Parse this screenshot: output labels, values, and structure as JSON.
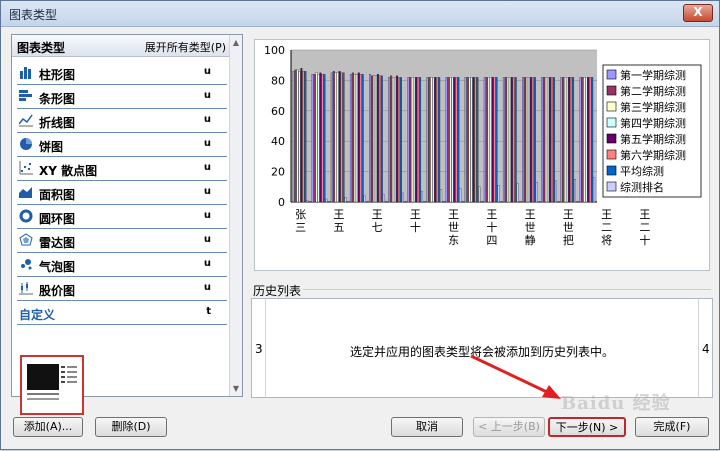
{
  "window": {
    "title": "图表类型",
    "close_label": "X"
  },
  "left_panel": {
    "header_title": "图表类型",
    "header_expand": "展开所有类型(P)",
    "items": [
      {
        "label": "柱形图",
        "mark": "u",
        "icon": "column-chart-icon"
      },
      {
        "label": "条形图",
        "mark": "u",
        "icon": "bar-chart-icon"
      },
      {
        "label": "折线图",
        "mark": "u",
        "icon": "line-chart-icon"
      },
      {
        "label": "饼图",
        "mark": "u",
        "icon": "pie-chart-icon"
      },
      {
        "label": "XY 散点图",
        "mark": "u",
        "icon": "scatter-chart-icon"
      },
      {
        "label": "面积图",
        "mark": "u",
        "icon": "area-chart-icon"
      },
      {
        "label": "圆环图",
        "mark": "u",
        "icon": "doughnut-chart-icon"
      },
      {
        "label": "雷达图",
        "mark": "u",
        "icon": "radar-chart-icon"
      },
      {
        "label": "气泡图",
        "mark": "u",
        "icon": "bubble-chart-icon"
      },
      {
        "label": "股价图",
        "mark": "u",
        "icon": "stock-chart-icon"
      }
    ],
    "custom": {
      "label": "自定义",
      "mark": "t"
    }
  },
  "chart_data": {
    "type": "bar",
    "ylim": [
      0,
      100
    ],
    "yticks": [
      "100",
      "80",
      "60",
      "40",
      "20",
      "0"
    ],
    "categories": [
      "张三",
      "王五",
      "王七",
      "王十",
      "王世东",
      "王十四",
      "王世静",
      "王世把",
      "王二将",
      "王二十"
    ],
    "groups_count": 16,
    "group_label_every": 2,
    "series": [
      {
        "name": "第一学期综测",
        "color": "#9999ff",
        "values": [
          86,
          84,
          85,
          84,
          84,
          82,
          82,
          82,
          82,
          82,
          82,
          82,
          82,
          82,
          82,
          82
        ]
      },
      {
        "name": "第二学期综测",
        "color": "#993366",
        "values": [
          87,
          84,
          86,
          85,
          83,
          83,
          82,
          82,
          82,
          82,
          82,
          82,
          82,
          82,
          82,
          82
        ]
      },
      {
        "name": "第三学期综测",
        "color": "#ffffcc",
        "values": [
          87,
          85,
          85,
          84,
          83,
          82,
          82,
          82,
          82,
          82,
          82,
          82,
          82,
          82,
          82,
          82
        ]
      },
      {
        "name": "第四学期综测",
        "color": "#ccffff",
        "values": [
          86,
          84,
          85,
          84,
          83,
          82,
          82,
          82,
          82,
          82,
          82,
          82,
          82,
          82,
          82,
          82
        ]
      },
      {
        "name": "第五学期综测",
        "color": "#660066",
        "values": [
          88,
          85,
          86,
          85,
          84,
          83,
          82,
          82,
          82,
          82,
          82,
          82,
          82,
          82,
          82,
          82
        ]
      },
      {
        "name": "第六学期综测",
        "color": "#ff8080",
        "values": [
          86,
          84,
          85,
          84,
          83,
          82,
          82,
          82,
          82,
          82,
          82,
          82,
          82,
          82,
          82,
          82
        ]
      },
      {
        "name": "平均综测",
        "color": "#0066cc",
        "values": [
          86,
          84,
          85,
          84,
          83,
          82,
          82,
          82,
          82,
          82,
          82,
          82,
          82,
          82,
          82,
          82
        ]
      },
      {
        "name": "综测排名",
        "color": "#ccccff",
        "values": [
          1,
          2,
          3,
          4,
          5,
          6,
          7,
          8,
          9,
          10,
          11,
          12,
          13,
          14,
          15,
          16
        ]
      }
    ],
    "plot_bg": "#c0c0c0"
  },
  "history": {
    "label": "历史列表",
    "left_index": "3",
    "right_index": "4",
    "message": "选定并应用的图表类型将会被添加到历史列表中。"
  },
  "buttons": {
    "add": "添加(A)...",
    "delete": "删除(D)",
    "cancel": "取消",
    "prev": "< 上一步(B)",
    "next": "下一步(N) >",
    "finish": "完成(F)"
  },
  "watermark": "Baidu 经验"
}
